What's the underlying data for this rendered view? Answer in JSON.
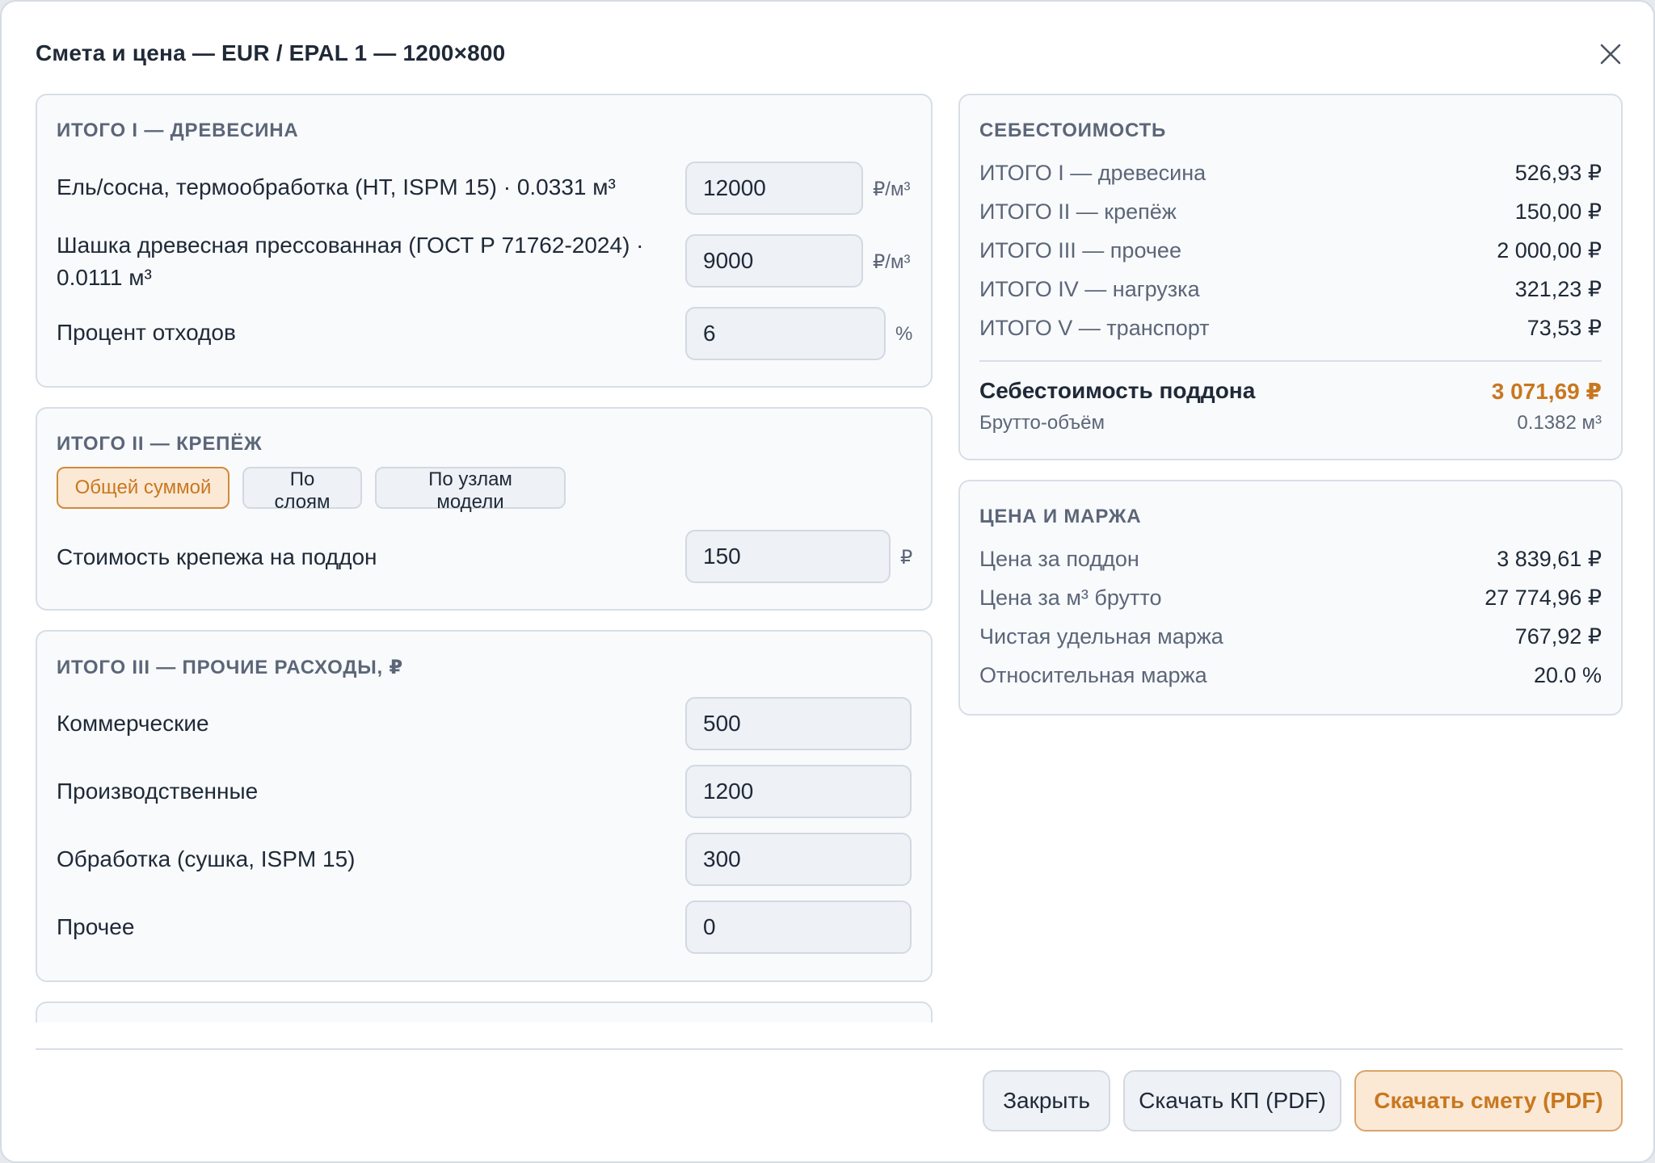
{
  "dialog": {
    "title": "Смета и цена — EUR / EPAL 1 — 1200×800"
  },
  "icons": {
    "close": "close-icon"
  },
  "wood": {
    "heading": "ИТОГО I — ДРЕВЕСИНА",
    "spruce": {
      "label": "Ель/сосна, термообработка (HT, ISPM 15) · 0.0331 м³",
      "value": "12000",
      "unit": "₽/м³"
    },
    "dowel": {
      "label_line1": "Шашка древесная прессованная (ГОСТ Р 71762-2024) ·",
      "label_line2": "0.0111 м³",
      "value": "9000",
      "unit": "₽/м³"
    },
    "waste": {
      "label": "Процент отходов",
      "value": "6",
      "unit": "%"
    }
  },
  "fasteners": {
    "heading": "ИТОГО II — КРЕПЁЖ",
    "modes": [
      "Общей суммой",
      "По слоям",
      "По узлам модели"
    ],
    "active_mode": "Общей суммой",
    "cost": {
      "label": "Стоимость крепежа на поддон",
      "value": "150",
      "unit": "₽"
    }
  },
  "other": {
    "heading": "ИТОГО III — ПРОЧИЕ РАСХОДЫ, ₽",
    "rows": [
      {
        "label": "Коммерческие",
        "value": "500"
      },
      {
        "label": "Производственные",
        "value": "1200"
      },
      {
        "label": "Обработка (сушка, ISPM 15)",
        "value": "300"
      },
      {
        "label": "Прочее",
        "value": "0"
      }
    ]
  },
  "cost_summary": {
    "heading": "СЕБЕСТОИМОСТЬ",
    "rows": [
      {
        "label": "ИТОГО I — древесина",
        "value": "526,93 ₽"
      },
      {
        "label": "ИТОГО II — крепёж",
        "value": "150,00 ₽"
      },
      {
        "label": "ИТОГО III — прочее",
        "value": "2 000,00 ₽"
      },
      {
        "label": "ИТОГО IV — нагрузка",
        "value": "321,23 ₽"
      },
      {
        "label": "ИТОГО V — транспорт",
        "value": "73,53 ₽"
      }
    ],
    "total_label": "Себестоимость поддона",
    "total_value": "3 071,69 ₽",
    "gross_label": "Брутто-объём",
    "gross_value": "0.1382 м³"
  },
  "price_margin": {
    "heading": "ЦЕНА И МАРЖА",
    "rows": [
      {
        "label": "Цена за поддон",
        "value": "3 839,61 ₽"
      },
      {
        "label": "Цена за м³ брутто",
        "value": "27 774,96 ₽"
      },
      {
        "label": "Чистая удельная маржа",
        "value": "767,92 ₽"
      },
      {
        "label": "Относительная маржа",
        "value": "20.0 %"
      }
    ]
  },
  "footer": {
    "close": "Закрыть",
    "download_offer": "Скачать КП (PDF)",
    "download_estimate": "Скачать смету (PDF)"
  },
  "colors": {
    "accent": "#c9771f",
    "accent_bg": "#fbe9d6",
    "muted_text": "#5c6678"
  }
}
